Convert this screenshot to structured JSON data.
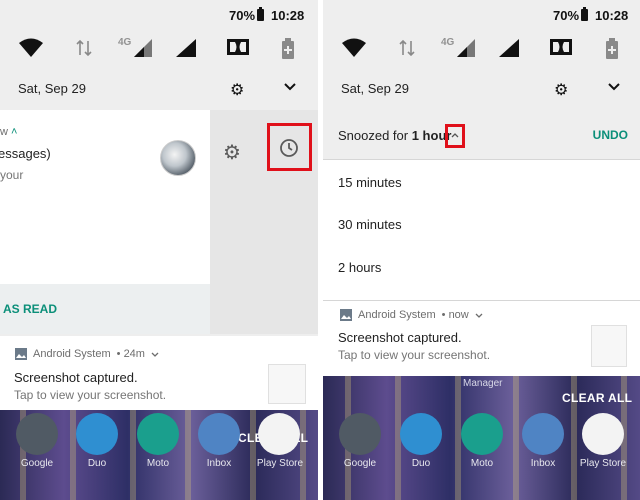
{
  "status_bar": {
    "battery": "70%",
    "time": "10:28"
  },
  "quick_settings": {
    "network_type": "4G"
  },
  "date": "Sat, Sep 29",
  "left": {
    "card_text": {
      "header_fragment": "w",
      "title_fragment": "essages)",
      "body_fragment": "your"
    },
    "mark_read": "AS READ",
    "notification": {
      "app": "Android System",
      "time": "• 24m",
      "title": "Screenshot captured.",
      "body": "Tap to view your screenshot."
    },
    "clear_all": "CLEAR ALL",
    "dock_apps": [
      "Google",
      "Duo",
      "Moto",
      "Inbox",
      "Play Store"
    ]
  },
  "right": {
    "snooze": {
      "prefix": "Snoozed for ",
      "duration": "1 hour",
      "undo": "UNDO"
    },
    "options": [
      "15 minutes",
      "30 minutes",
      "2 hours"
    ],
    "notification": {
      "app": "Android System",
      "time": "• now",
      "title": "Screenshot captured.",
      "body": "Tap to view your screenshot."
    },
    "wallpaper_label": "Manager",
    "clear_all": "CLEAR ALL",
    "dock_apps": [
      "Google",
      "Duo",
      "Moto",
      "Inbox",
      "Play Store"
    ]
  },
  "colors": {
    "accent_teal": "#0b8f79",
    "highlight_red": "#e0101a"
  }
}
